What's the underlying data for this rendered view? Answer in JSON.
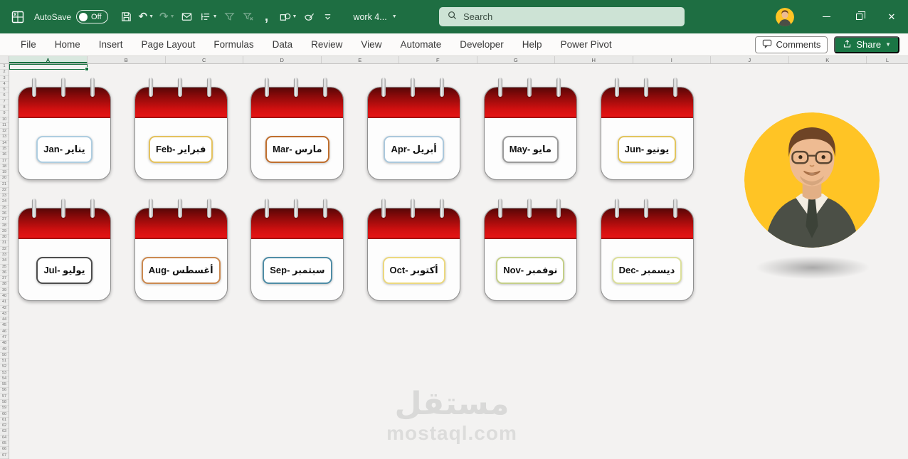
{
  "titlebar": {
    "app_name": "Excel",
    "autosave_label": "AutoSave",
    "autosave_state": "Off",
    "document_title": "work 4...",
    "search_placeholder": "Search",
    "qat": [
      {
        "icon": "save-icon"
      },
      {
        "icon": "undo-icon",
        "dropdown": true
      },
      {
        "icon": "redo-icon",
        "dropdown": true,
        "disabled": true
      },
      {
        "icon": "mail-icon"
      },
      {
        "icon": "outline-icon",
        "dropdown": true
      },
      {
        "icon": "reapply-filter-icon",
        "disabled": true
      },
      {
        "icon": "clear-filter-icon",
        "disabled": true
      },
      {
        "icon": "comma-style-icon"
      },
      {
        "icon": "shapes-icon",
        "dropdown": true
      },
      {
        "icon": "edit-shape-icon"
      },
      {
        "icon": "customize-qat-icon"
      }
    ]
  },
  "menubar": {
    "tabs": [
      "File",
      "Home",
      "Insert",
      "Page Layout",
      "Formulas",
      "Data",
      "Review",
      "View",
      "Automate",
      "Developer",
      "Help",
      "Power Pivot"
    ],
    "comments_label": "Comments",
    "share_label": "Share"
  },
  "grid": {
    "columns": [
      "A",
      "B",
      "C",
      "D",
      "E",
      "F",
      "G",
      "H",
      "I",
      "J",
      "K",
      "L"
    ],
    "row_count": 67,
    "selected_cell": "A1",
    "selected_column": "A"
  },
  "calendar": {
    "months": [
      {
        "key": "jan",
        "label": "Jan- يناير",
        "border_color": "#aecde0"
      },
      {
        "key": "feb",
        "label": "Feb- فبراير",
        "border_color": "#e4c25e"
      },
      {
        "key": "mar",
        "label": "Mar- مارس",
        "border_color": "#bf6e2d"
      },
      {
        "key": "apr",
        "label": "Apr- أبريل",
        "border_color": "#abc8dc"
      },
      {
        "key": "may",
        "label": "May- مايو",
        "border_color": "#9b9b9b"
      },
      {
        "key": "jun",
        "label": "Jun- يونيو",
        "border_color": "#e2c55e"
      },
      {
        "key": "jul",
        "label": "Jul- يوليو",
        "border_color": "#4d4d4d"
      },
      {
        "key": "aug",
        "label": "Aug- أغسطس",
        "border_color": "#cb8950"
      },
      {
        "key": "sep",
        "label": "Sep- سبتمبر",
        "border_color": "#4f8da6"
      },
      {
        "key": "oct",
        "label": "Oct- أكتوبر",
        "border_color": "#ecd87e"
      },
      {
        "key": "nov",
        "label": "Nov- نوفمبر",
        "border_color": "#c4cf88"
      },
      {
        "key": "dec",
        "label": "Dec- ديسمبر",
        "border_color": "#dbdf9a"
      }
    ]
  },
  "watermark": {
    "logo_text": "مستقل",
    "site_text": "mostaql.com"
  },
  "colors": {
    "titlebar_green": "#1e6e42",
    "share_green": "#1a7544",
    "selection_green": "#17703f",
    "calendar_red_top": "#580606",
    "calendar_red_bottom": "#e51414",
    "avatar_background": "#ffc425",
    "watermark_gray": "#d9d9d8"
  }
}
